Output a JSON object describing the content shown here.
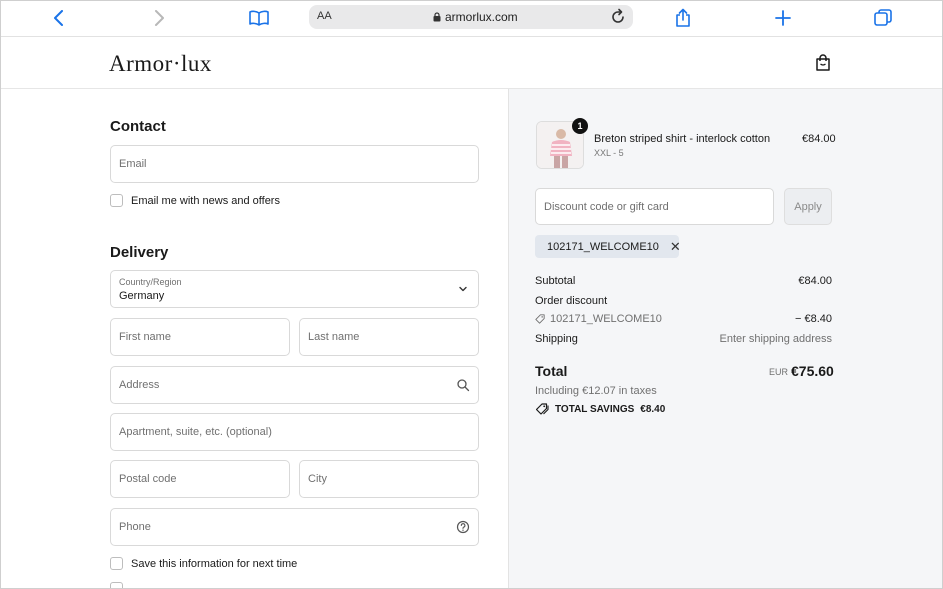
{
  "browser": {
    "reader_label": "AA",
    "url": "armorlux.com"
  },
  "store": {
    "logo_text": "Armor·lux"
  },
  "contact": {
    "title": "Contact",
    "email_placeholder": "Email",
    "newsletter_label": "Email me with news and offers"
  },
  "delivery": {
    "title": "Delivery",
    "country_label": "Country/Region",
    "country_value": "Germany",
    "first_name_placeholder": "First name",
    "last_name_placeholder": "Last name",
    "address_placeholder": "Address",
    "apartment_placeholder": "Apartment, suite, etc. (optional)",
    "postal_placeholder": "Postal code",
    "city_placeholder": "City",
    "phone_placeholder": "Phone",
    "save_info_label": "Save this information for next time"
  },
  "cart": {
    "item": {
      "quantity": "1",
      "name": "Breton striped shirt - interlock cotton",
      "variant": "XXL - 5",
      "price": "€84.00"
    },
    "discount_placeholder": "Discount code or gift card",
    "apply_label": "Apply",
    "applied_code": "102171_WELCOME10"
  },
  "summary": {
    "subtotal_label": "Subtotal",
    "subtotal_value": "€84.00",
    "order_discount_label": "Order discount",
    "discount_code": "102171_WELCOME10",
    "discount_value": "− €8.40",
    "shipping_label": "Shipping",
    "shipping_value": "Enter shipping address",
    "total_label": "Total",
    "currency": "EUR",
    "total_value": "€75.60",
    "tax_note": "Including €12.07 in taxes",
    "savings_label": "TOTAL SAVINGS",
    "savings_value": "€8.40"
  }
}
